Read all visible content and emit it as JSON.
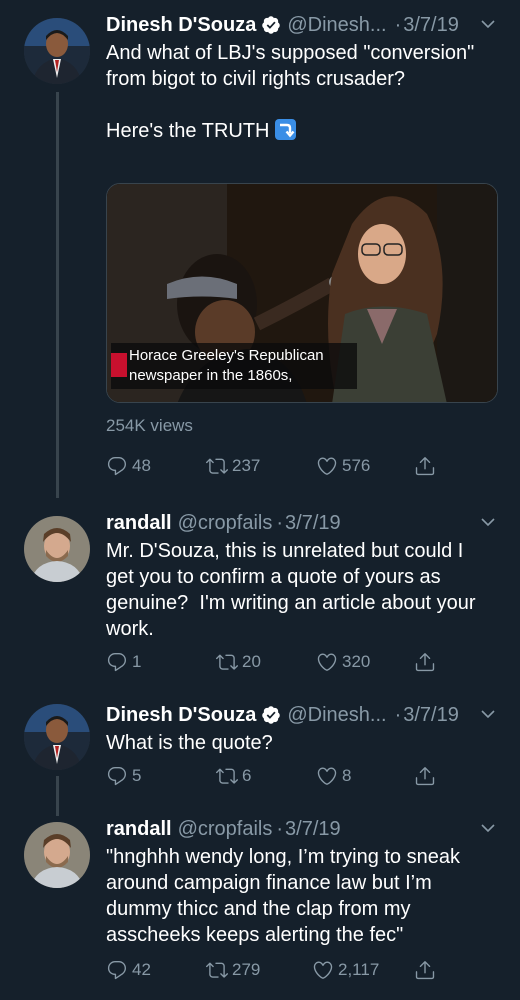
{
  "tweets": [
    {
      "name": "Dinesh D'Souza",
      "handle": "@Dinesh...",
      "sep": "·",
      "date": "3/7/19",
      "text": "And what of LBJ's supposed \"conversion\" from bigot to civil rights crusader?\n\nHere's the TRUTH",
      "replies": "48",
      "retweets": "237",
      "likes": "576",
      "verified": true
    },
    {
      "name": "randall",
      "handle": "@cropfails",
      "sep": "·",
      "date": "3/7/19",
      "text": "Mr. D'Souza, this is unrelated but could I get you to confirm a quote of yours as genuine?  I'm writing an article about your work.",
      "replies": "1",
      "retweets": "20",
      "likes": "320",
      "verified": false
    },
    {
      "name": "Dinesh D'Souza",
      "handle": "@Dinesh...",
      "sep": "·",
      "date": "3/7/19",
      "text": "What is the quote?",
      "replies": "5",
      "retweets": "6",
      "likes": "8",
      "verified": true
    },
    {
      "name": "randall",
      "handle": "@cropfails",
      "sep": "·",
      "date": "3/7/19",
      "text": "\"hnghhh wendy long, I’m trying to sneak around campaign finance law but I’m dummy thicc and the clap from my asscheeks keeps alerting the fec\"",
      "replies": "42",
      "retweets": "279",
      "likes": "2,117",
      "verified": false
    }
  ],
  "media": {
    "caption": "Horace Greeley's Republican newspaper in the 1860s,",
    "views": "254K views"
  },
  "colors": {
    "background": "#15202b",
    "secondary_text": "#8899a6",
    "verified_blue": "#1da1f2",
    "thread_line": "#38444d"
  },
  "icons": {
    "reply": "reply-icon",
    "retweet": "retweet-icon",
    "like": "heart-icon",
    "share": "share-icon",
    "verified": "verified-badge-icon",
    "more": "chevron-down-icon",
    "emoji": "right-arrow-curving-down-emoji-icon"
  }
}
